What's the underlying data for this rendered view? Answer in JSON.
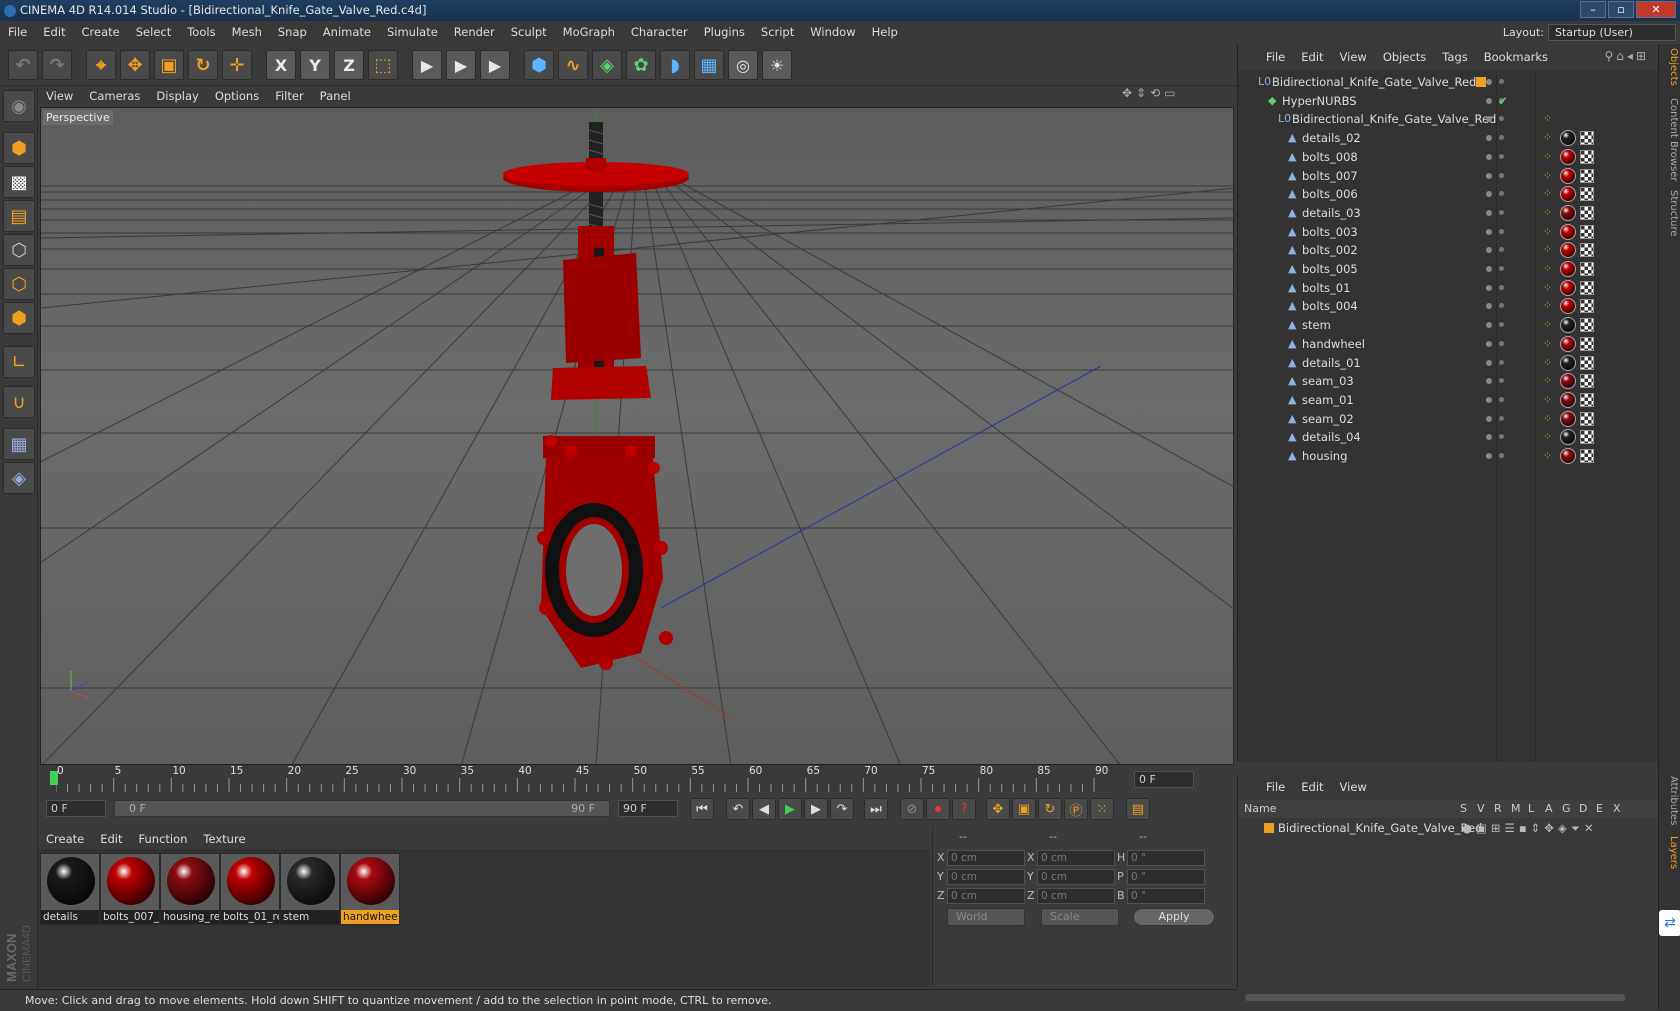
{
  "window": {
    "title": "CINEMA 4D R14.014 Studio - [Bidirectional_Knife_Gate_Valve_Red.c4d]"
  },
  "menubar": [
    "File",
    "Edit",
    "Create",
    "Select",
    "Tools",
    "Mesh",
    "Snap",
    "Animate",
    "Simulate",
    "Render",
    "Sculpt",
    "MoGraph",
    "Character",
    "Plugins",
    "Script",
    "Window",
    "Help"
  ],
  "layout": {
    "label": "Layout:",
    "value": "Startup (User)"
  },
  "toolbar": {
    "axis_x": "X",
    "axis_y": "Y",
    "axis_z": "Z"
  },
  "viewport": {
    "menu": [
      "View",
      "Cameras",
      "Display",
      "Options",
      "Filter",
      "Panel"
    ],
    "label": "Perspective",
    "model_color": "#b00000"
  },
  "timeline": {
    "ticks": [
      "0",
      "5",
      "10",
      "15",
      "20",
      "25",
      "30",
      "35",
      "40",
      "45",
      "50",
      "55",
      "60",
      "65",
      "70",
      "75",
      "80",
      "85",
      "90"
    ],
    "frame_right": "0 F",
    "start": "0 F",
    "range_start": "0 F",
    "range_end": "90 F",
    "end": "90 F"
  },
  "materials": {
    "menu": [
      "Create",
      "Edit",
      "Function",
      "Texture"
    ],
    "items": [
      {
        "name": "details",
        "color": "#1a1a1a"
      },
      {
        "name": "bolts_007_",
        "color": "#c00000"
      },
      {
        "name": "housing_re",
        "color": "#8a0c10"
      },
      {
        "name": "bolts_01_re",
        "color": "#c00000"
      },
      {
        "name": "stem",
        "color": "#2a2a2a"
      },
      {
        "name": "handwhee",
        "color": "#a80a10",
        "selected": true
      }
    ]
  },
  "coords": {
    "headers": [
      "--",
      "--",
      "--"
    ],
    "rows": [
      {
        "a": "X",
        "av": "0 cm",
        "b": "X",
        "bv": "0 cm",
        "c": "H",
        "cv": "0 °"
      },
      {
        "a": "Y",
        "av": "0 cm",
        "b": "Y",
        "bv": "0 cm",
        "c": "P",
        "cv": "0 °"
      },
      {
        "a": "Z",
        "av": "0 cm",
        "b": "Z",
        "bv": "0 cm",
        "c": "B",
        "cv": "0 °"
      }
    ],
    "world": "World",
    "scale": "Scale",
    "apply": "Apply"
  },
  "status": "Move: Click and drag to move elements. Hold down SHIFT to quantize movement / add to the selection in point mode, CTRL to remove.",
  "objects": {
    "menu": [
      "File",
      "Edit",
      "View",
      "Objects",
      "Tags",
      "Bookmarks"
    ],
    "root": "Bidirectional_Knife_Gate_Valve_Red",
    "nurbs": "HyperNURBS",
    "group": "Bidirectional_Knife_Gate_Valve_Red",
    "items": [
      {
        "name": "details_02",
        "mat": "#222"
      },
      {
        "name": "bolts_008",
        "mat": "#c00000"
      },
      {
        "name": "bolts_007",
        "mat": "#c00000"
      },
      {
        "name": "bolts_006",
        "mat": "#c00000"
      },
      {
        "name": "details_03",
        "mat": "#8a0c10"
      },
      {
        "name": "bolts_003",
        "mat": "#c00000"
      },
      {
        "name": "bolts_002",
        "mat": "#c00000"
      },
      {
        "name": "bolts_005",
        "mat": "#c00000"
      },
      {
        "name": "bolts_01",
        "mat": "#c00000"
      },
      {
        "name": "bolts_004",
        "mat": "#c00000"
      },
      {
        "name": "stem",
        "mat": "#222"
      },
      {
        "name": "handwheel",
        "mat": "#a80a10"
      },
      {
        "name": "details_01",
        "mat": "#222"
      },
      {
        "name": "seam_03",
        "mat": "#8a0c10"
      },
      {
        "name": "seam_01",
        "mat": "#8a0c10"
      },
      {
        "name": "seam_02",
        "mat": "#8a0c10"
      },
      {
        "name": "details_04",
        "mat": "#222"
      },
      {
        "name": "housing",
        "mat": "#8a0c10"
      }
    ]
  },
  "layers": {
    "menu": [
      "File",
      "Edit",
      "View"
    ],
    "name_header": "Name",
    "cols": [
      "S",
      "V",
      "R",
      "M",
      "L",
      "A",
      "G",
      "D",
      "E",
      "X"
    ],
    "row": "Bidirectional_Knife_Gate_Valve_Red"
  },
  "side_tabs": [
    "Objects",
    "Content Browser",
    "Structure",
    "Attributes",
    "Layers"
  ]
}
